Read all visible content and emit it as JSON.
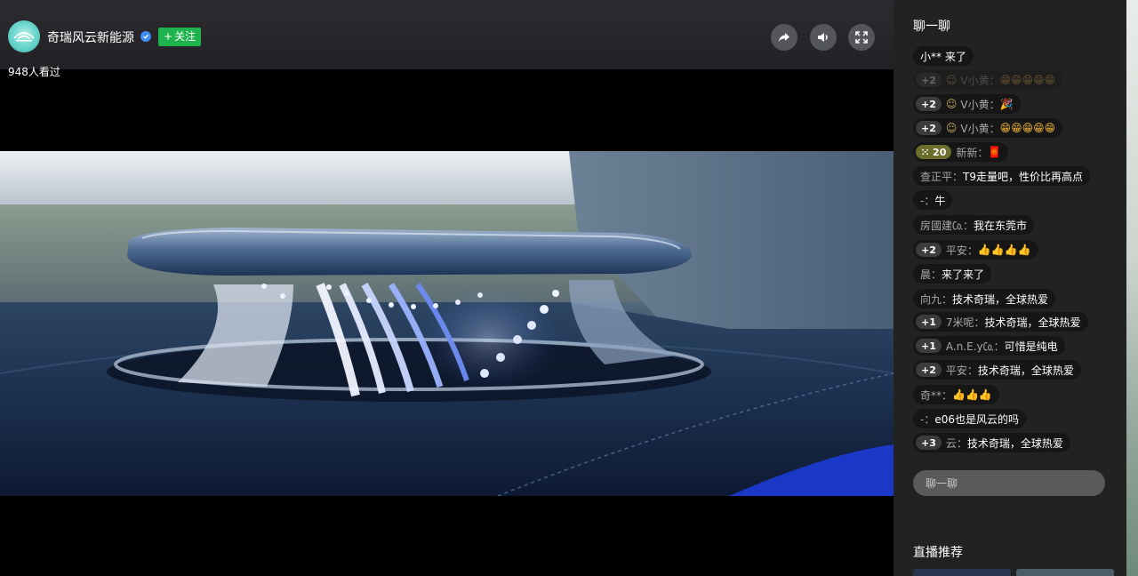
{
  "channel": {
    "name": "奇瑞风云新能源",
    "follow_label": "关注",
    "follow_plus": "+",
    "view_count": "948人看过"
  },
  "icons": {
    "share": "share-icon",
    "volume": "volume-icon",
    "fullscreen": "fullscreen-icon",
    "verified": "verified-icon",
    "avatar": "chery-logo-icon"
  },
  "colors": {
    "follow_button": "#1fb34e",
    "verified": "#3d8df5",
    "avatar": "#6fd8cf",
    "chat_bg": "#222222",
    "badge_level20": "#6b6e2c"
  },
  "chat": {
    "title": "聊一聊",
    "input_placeholder": "聊一聊",
    "messages": [
      {
        "badge": "",
        "smiley": "",
        "user": "小**",
        "content": "来了",
        "emojis": ""
      },
      {
        "badge": "+2",
        "smiley": "☺",
        "user": "V小黄：",
        "content": "",
        "emojis": "😁😁😁😁😁"
      },
      {
        "badge": "+2",
        "smiley": "☺",
        "user": "V小黄：",
        "content": "",
        "emojis": "🎉"
      },
      {
        "badge": "+2",
        "smiley": "☺",
        "user": "V小黄：",
        "content": "",
        "emojis": "😁😁😁😁😁"
      },
      {
        "badge": "20",
        "smiley": "",
        "user": "新新：",
        "content": "",
        "emojis": "🧧"
      },
      {
        "badge": "",
        "smiley": "",
        "user": "查正平：",
        "content": "T9走量吧，性价比再高点",
        "emojis": ""
      },
      {
        "badge": "",
        "smiley": "",
        "user": "-：",
        "content": "牛",
        "emojis": ""
      },
      {
        "badge": "",
        "smiley": "",
        "user": "房國建㏇：",
        "content": "我在东莞市",
        "emojis": ""
      },
      {
        "badge": "+2",
        "smiley": "",
        "user": "平安：",
        "content": "",
        "emojis": "👍👍👍👍"
      },
      {
        "badge": "",
        "smiley": "",
        "user": "晨：",
        "content": "来了来了",
        "emojis": ""
      },
      {
        "badge": "",
        "smiley": "",
        "user": "向九：",
        "content": "技术奇瑞，全球热爱",
        "emojis": ""
      },
      {
        "badge": "+1",
        "smiley": "",
        "user": "7米呢：",
        "content": "技术奇瑞，全球热爱",
        "emojis": ""
      },
      {
        "badge": "+1",
        "smiley": "",
        "user": "A.n.E.y㏇：",
        "content": "可惜是纯电",
        "emojis": ""
      },
      {
        "badge": "+2",
        "smiley": "",
        "user": "平安：",
        "content": "技术奇瑞，全球热爱",
        "emojis": ""
      },
      {
        "badge": "",
        "smiley": "",
        "user": "奇**：",
        "content": "",
        "emojis": "👍👍👍"
      },
      {
        "badge": "",
        "smiley": "",
        "user": "-：",
        "content": "e06也是风云的吗",
        "emojis": ""
      },
      {
        "badge": "+3",
        "smiley": "",
        "user": "云：",
        "content": "技术奇瑞，全球热爱",
        "emojis": ""
      }
    ]
  },
  "recommend": {
    "title": "直播推荐"
  }
}
